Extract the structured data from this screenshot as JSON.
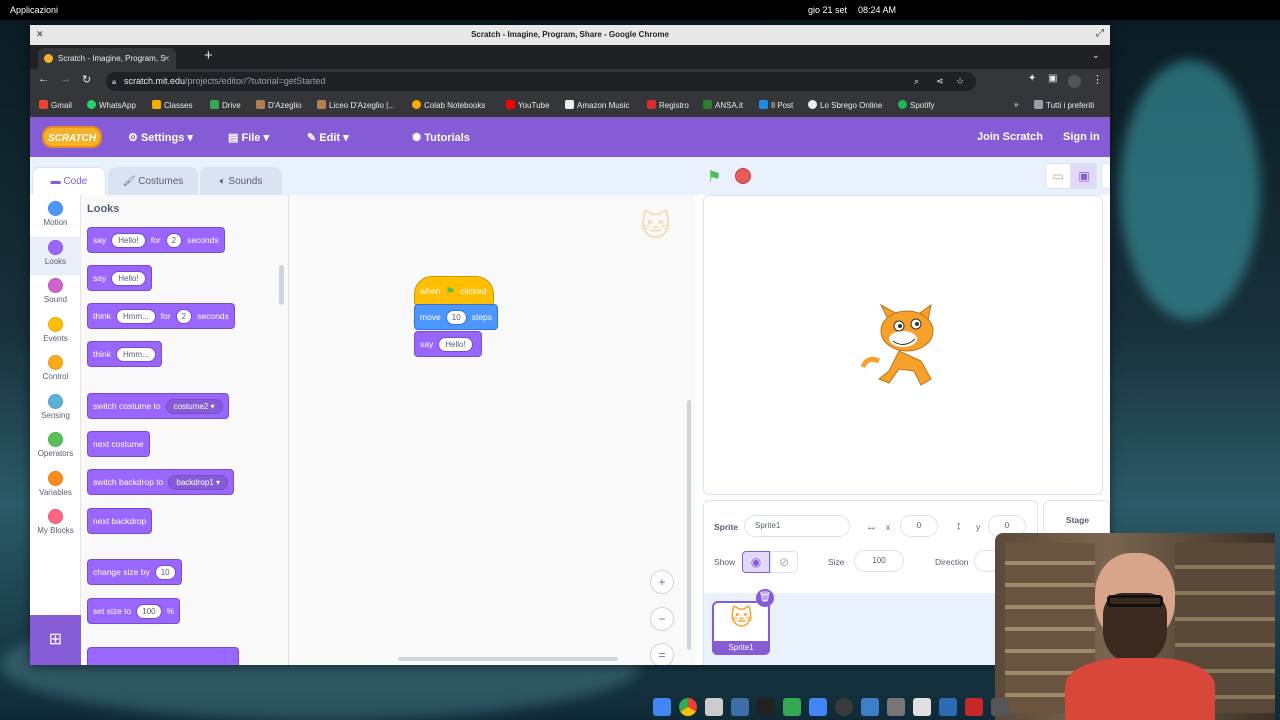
{
  "desktop": {
    "apps_label": "Applicazioni",
    "date": "gio 21 set",
    "time": "08:24 AM"
  },
  "browser": {
    "window_title": "Scratch - Imagine, Program, Share - Google Chrome",
    "tab_title": "Scratch - Imagine, Program, S",
    "url_host": "scratch.mit.edu",
    "url_path": "/projects/editor/?tutorial=getStarted",
    "bookmarks": [
      "Gmail",
      "WhatsApp",
      "Classes",
      "Drive",
      "D'Azeglio",
      "Liceo D'Azeglio |...",
      "Colab Notebooks",
      "YouTube",
      "Amazon Music",
      "Registro",
      "ANSA.it",
      "Il Post",
      "Lo Sbrego Online",
      "Spotify"
    ],
    "all_bookmarks": "Tutti i preferiti"
  },
  "scratch": {
    "logo": "SCRATCH",
    "menu": {
      "settings": "Settings",
      "file": "File",
      "edit": "Edit",
      "tutorials": "Tutorials",
      "join": "Join Scratch",
      "signin": "Sign in"
    },
    "tabs": {
      "code": "Code",
      "costumes": "Costumes",
      "sounds": "Sounds"
    },
    "categories": [
      {
        "label": "Motion",
        "color": "#4c97ff"
      },
      {
        "label": "Looks",
        "color": "#9966ff"
      },
      {
        "label": "Sound",
        "color": "#cf63cf"
      },
      {
        "label": "Events",
        "color": "#ffbf00"
      },
      {
        "label": "Control",
        "color": "#ffab19"
      },
      {
        "label": "Sensing",
        "color": "#5cb1d6"
      },
      {
        "label": "Operators",
        "color": "#59c059"
      },
      {
        "label": "Variables",
        "color": "#ff8c1a"
      },
      {
        "label": "My Blocks",
        "color": "#ff6680"
      }
    ],
    "palette": {
      "title": "Looks",
      "say_for": {
        "w1": "say",
        "v1": "Hello!",
        "w2": "for",
        "v2": "2",
        "w3": "seconds"
      },
      "say": {
        "w1": "say",
        "v1": "Hello!"
      },
      "think_for": {
        "w1": "think",
        "v1": "Hmm...",
        "w2": "for",
        "v2": "2",
        "w3": "seconds"
      },
      "think": {
        "w1": "think",
        "v1": "Hmm..."
      },
      "switch_costume": {
        "w1": "switch costume to",
        "v1": "costume2"
      },
      "next_costume": "next costume",
      "switch_backdrop": {
        "w1": "switch backdrop to",
        "v1": "backdrop1"
      },
      "next_backdrop": "next backdrop",
      "change_size": {
        "w1": "change size by",
        "v1": "10"
      },
      "set_size": {
        "w1": "set size to",
        "v1": "100",
        "w2": "%"
      }
    },
    "script": {
      "hat": {
        "w1": "when",
        "w2": "clicked"
      },
      "move": {
        "w1": "move",
        "v1": "10",
        "w2": "steps"
      },
      "say": {
        "w1": "say",
        "v1": "Hello!"
      }
    },
    "sprite_info": {
      "sprite_label": "Sprite",
      "sprite_name": "Sprite1",
      "x_label": "x",
      "x": "0",
      "y_label": "y",
      "y": "0",
      "show_label": "Show",
      "size_label": "Size",
      "size": "100",
      "direction_label": "Direction",
      "stage_label": "Stage",
      "thumb_name": "Sprite1"
    }
  }
}
